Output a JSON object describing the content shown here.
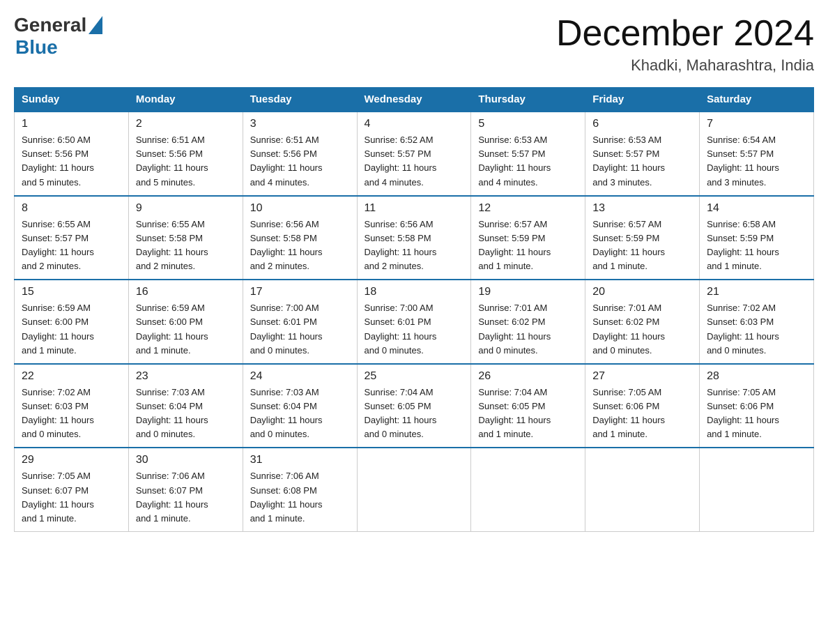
{
  "header": {
    "month_year": "December 2024",
    "location": "Khadki, Maharashtra, India",
    "logo_general": "General",
    "logo_blue": "Blue"
  },
  "days_of_week": [
    "Sunday",
    "Monday",
    "Tuesday",
    "Wednesday",
    "Thursday",
    "Friday",
    "Saturday"
  ],
  "weeks": [
    [
      {
        "day": "1",
        "sunrise": "6:50 AM",
        "sunset": "5:56 PM",
        "daylight": "11 hours and 5 minutes."
      },
      {
        "day": "2",
        "sunrise": "6:51 AM",
        "sunset": "5:56 PM",
        "daylight": "11 hours and 5 minutes."
      },
      {
        "day": "3",
        "sunrise": "6:51 AM",
        "sunset": "5:56 PM",
        "daylight": "11 hours and 4 minutes."
      },
      {
        "day": "4",
        "sunrise": "6:52 AM",
        "sunset": "5:57 PM",
        "daylight": "11 hours and 4 minutes."
      },
      {
        "day": "5",
        "sunrise": "6:53 AM",
        "sunset": "5:57 PM",
        "daylight": "11 hours and 4 minutes."
      },
      {
        "day": "6",
        "sunrise": "6:53 AM",
        "sunset": "5:57 PM",
        "daylight": "11 hours and 3 minutes."
      },
      {
        "day": "7",
        "sunrise": "6:54 AM",
        "sunset": "5:57 PM",
        "daylight": "11 hours and 3 minutes."
      }
    ],
    [
      {
        "day": "8",
        "sunrise": "6:55 AM",
        "sunset": "5:57 PM",
        "daylight": "11 hours and 2 minutes."
      },
      {
        "day": "9",
        "sunrise": "6:55 AM",
        "sunset": "5:58 PM",
        "daylight": "11 hours and 2 minutes."
      },
      {
        "day": "10",
        "sunrise": "6:56 AM",
        "sunset": "5:58 PM",
        "daylight": "11 hours and 2 minutes."
      },
      {
        "day": "11",
        "sunrise": "6:56 AM",
        "sunset": "5:58 PM",
        "daylight": "11 hours and 2 minutes."
      },
      {
        "day": "12",
        "sunrise": "6:57 AM",
        "sunset": "5:59 PM",
        "daylight": "11 hours and 1 minute."
      },
      {
        "day": "13",
        "sunrise": "6:57 AM",
        "sunset": "5:59 PM",
        "daylight": "11 hours and 1 minute."
      },
      {
        "day": "14",
        "sunrise": "6:58 AM",
        "sunset": "5:59 PM",
        "daylight": "11 hours and 1 minute."
      }
    ],
    [
      {
        "day": "15",
        "sunrise": "6:59 AM",
        "sunset": "6:00 PM",
        "daylight": "11 hours and 1 minute."
      },
      {
        "day": "16",
        "sunrise": "6:59 AM",
        "sunset": "6:00 PM",
        "daylight": "11 hours and 1 minute."
      },
      {
        "day": "17",
        "sunrise": "7:00 AM",
        "sunset": "6:01 PM",
        "daylight": "11 hours and 0 minutes."
      },
      {
        "day": "18",
        "sunrise": "7:00 AM",
        "sunset": "6:01 PM",
        "daylight": "11 hours and 0 minutes."
      },
      {
        "day": "19",
        "sunrise": "7:01 AM",
        "sunset": "6:02 PM",
        "daylight": "11 hours and 0 minutes."
      },
      {
        "day": "20",
        "sunrise": "7:01 AM",
        "sunset": "6:02 PM",
        "daylight": "11 hours and 0 minutes."
      },
      {
        "day": "21",
        "sunrise": "7:02 AM",
        "sunset": "6:03 PM",
        "daylight": "11 hours and 0 minutes."
      }
    ],
    [
      {
        "day": "22",
        "sunrise": "7:02 AM",
        "sunset": "6:03 PM",
        "daylight": "11 hours and 0 minutes."
      },
      {
        "day": "23",
        "sunrise": "7:03 AM",
        "sunset": "6:04 PM",
        "daylight": "11 hours and 0 minutes."
      },
      {
        "day": "24",
        "sunrise": "7:03 AM",
        "sunset": "6:04 PM",
        "daylight": "11 hours and 0 minutes."
      },
      {
        "day": "25",
        "sunrise": "7:04 AM",
        "sunset": "6:05 PM",
        "daylight": "11 hours and 0 minutes."
      },
      {
        "day": "26",
        "sunrise": "7:04 AM",
        "sunset": "6:05 PM",
        "daylight": "11 hours and 1 minute."
      },
      {
        "day": "27",
        "sunrise": "7:05 AM",
        "sunset": "6:06 PM",
        "daylight": "11 hours and 1 minute."
      },
      {
        "day": "28",
        "sunrise": "7:05 AM",
        "sunset": "6:06 PM",
        "daylight": "11 hours and 1 minute."
      }
    ],
    [
      {
        "day": "29",
        "sunrise": "7:05 AM",
        "sunset": "6:07 PM",
        "daylight": "11 hours and 1 minute."
      },
      {
        "day": "30",
        "sunrise": "7:06 AM",
        "sunset": "6:07 PM",
        "daylight": "11 hours and 1 minute."
      },
      {
        "day": "31",
        "sunrise": "7:06 AM",
        "sunset": "6:08 PM",
        "daylight": "11 hours and 1 minute."
      },
      null,
      null,
      null,
      null
    ]
  ],
  "labels": {
    "sunrise": "Sunrise:",
    "sunset": "Sunset:",
    "daylight": "Daylight:"
  }
}
